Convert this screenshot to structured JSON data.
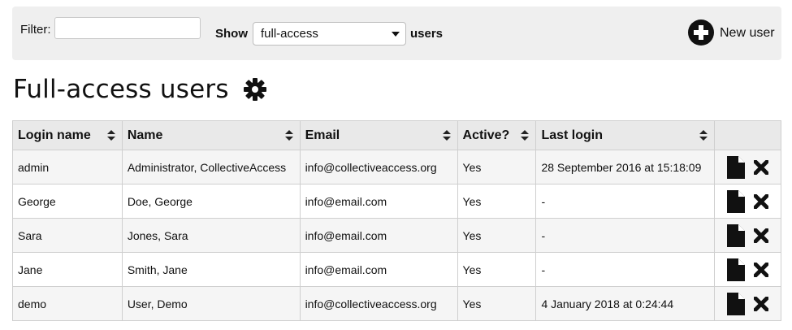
{
  "toolbar": {
    "filter_label": "Filter:",
    "filter_value": "",
    "show_label": "Show",
    "selected_option": "full-access",
    "users_label": "users",
    "new_user_label": "New user"
  },
  "page": {
    "title": "Full-access users"
  },
  "table": {
    "headers": {
      "login": "Login name",
      "name": "Name",
      "email": "Email",
      "active": "Active?",
      "last_login": "Last login"
    },
    "rows": [
      {
        "login": "admin",
        "name": "Administrator, CollectiveAccess",
        "email": "info@collectiveaccess.org",
        "active": "Yes",
        "last_login": "28 September 2016 at 15:18:09"
      },
      {
        "login": "George",
        "name": "Doe, George",
        "email": "info@email.com",
        "active": "Yes",
        "last_login": "-"
      },
      {
        "login": "Sara",
        "name": "Jones, Sara",
        "email": "info@email.com",
        "active": "Yes",
        "last_login": "-"
      },
      {
        "login": "Jane",
        "name": "Smith, Jane",
        "email": "info@email.com",
        "active": "Yes",
        "last_login": "-"
      },
      {
        "login": "demo",
        "name": "User, Demo",
        "email": "info@collectiveaccess.org",
        "active": "Yes",
        "last_login": "4 January 2018 at 0:24:44"
      }
    ]
  },
  "icons": {
    "new_user": "plus-circle-icon",
    "settings": "gear-icon",
    "edit": "document-icon",
    "delete": "close-icon"
  }
}
